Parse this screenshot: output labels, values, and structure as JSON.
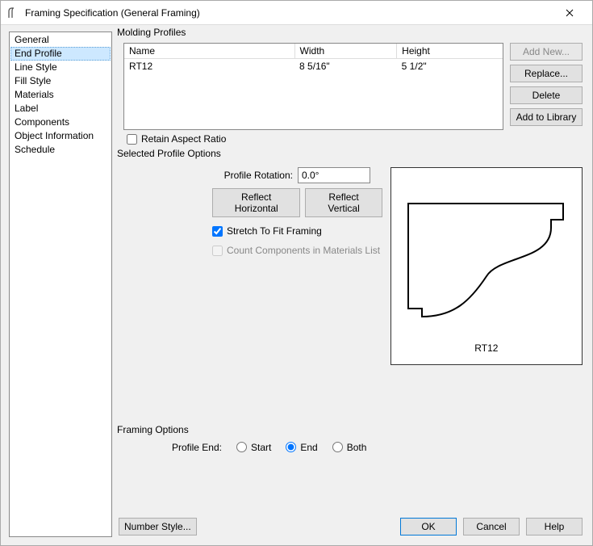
{
  "window": {
    "title": "Framing Specification (General Framing)"
  },
  "sidebar": {
    "items": [
      {
        "label": "General"
      },
      {
        "label": "End Profile"
      },
      {
        "label": "Line Style"
      },
      {
        "label": "Fill Style"
      },
      {
        "label": "Materials"
      },
      {
        "label": "Label"
      },
      {
        "label": "Components"
      },
      {
        "label": "Object Information"
      },
      {
        "label": "Schedule"
      }
    ]
  },
  "molding": {
    "group_label": "Molding Profiles",
    "columns": {
      "name": "Name",
      "width": "Width",
      "height": "Height"
    },
    "rows": [
      {
        "name": "RT12",
        "width": "8 5/16\"",
        "height": "5 1/2\""
      }
    ],
    "buttons": {
      "add_new": "Add New...",
      "replace": "Replace...",
      "delete": "Delete",
      "add_to_library": "Add to Library"
    },
    "retain_aspect": "Retain Aspect Ratio"
  },
  "profile_options": {
    "group_label": "Selected Profile Options",
    "rotation_label": "Profile Rotation:",
    "rotation_value": "0.0°",
    "reflect_h": "Reflect Horizontal",
    "reflect_v": "Reflect Vertical",
    "stretch": "Stretch To Fit Framing",
    "count_components": "Count Components in Materials List",
    "preview_label": "RT12"
  },
  "framing_options": {
    "group_label": "Framing Options",
    "profile_end_label": "Profile End:",
    "start": "Start",
    "end": "End",
    "both": "Both"
  },
  "footer": {
    "number_style": "Number Style...",
    "ok": "OK",
    "cancel": "Cancel",
    "help": "Help"
  }
}
